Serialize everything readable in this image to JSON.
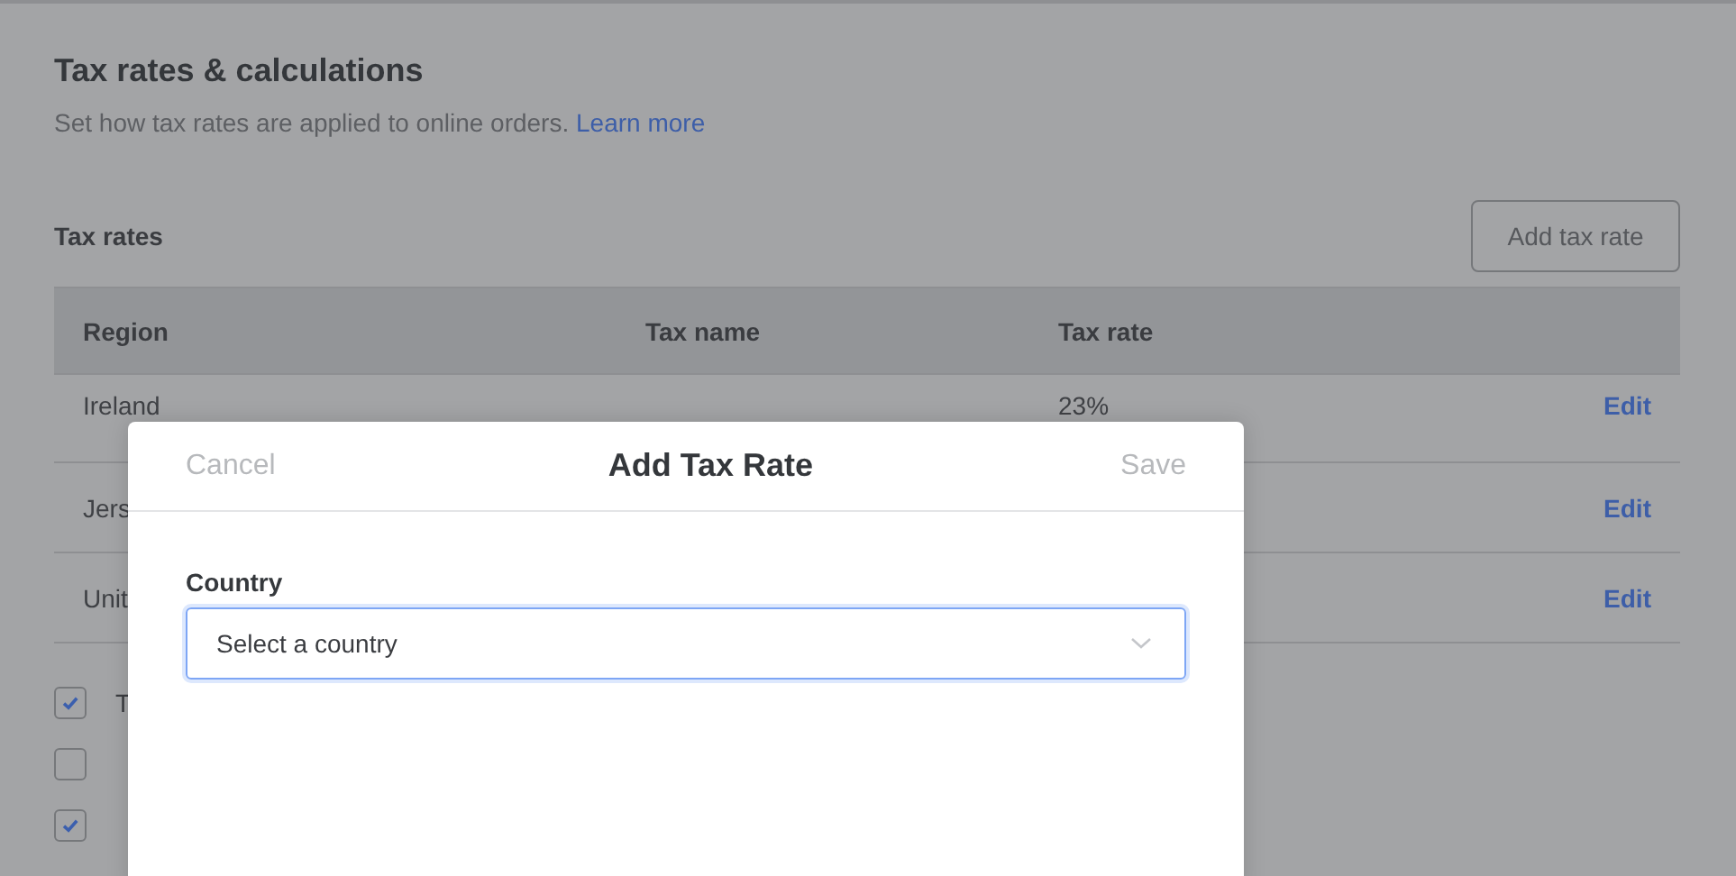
{
  "page": {
    "title": "Tax rates & calculations",
    "description": "Set how tax rates are applied to online orders.",
    "learn_more_link": "Learn more"
  },
  "tax_rates": {
    "label": "Tax rates",
    "add_button": "Add tax rate",
    "columns": [
      "Region",
      "Tax name",
      "Tax rate"
    ],
    "rows": [
      {
        "region": "Ireland",
        "tax_rate": "23%",
        "action": "Edit"
      },
      {
        "region": "Jers",
        "action": "Edit"
      },
      {
        "region": "Unit",
        "action": "Edit"
      }
    ]
  },
  "options": [
    {
      "label": "T",
      "checked": true
    },
    {
      "checked": false
    },
    {
      "checked": true
    }
  ],
  "modal": {
    "cancel": "Cancel",
    "title": "Add Tax Rate",
    "save": "Save",
    "save_disabled": true,
    "field_label": "Country",
    "placeholder": "Select a country"
  }
}
